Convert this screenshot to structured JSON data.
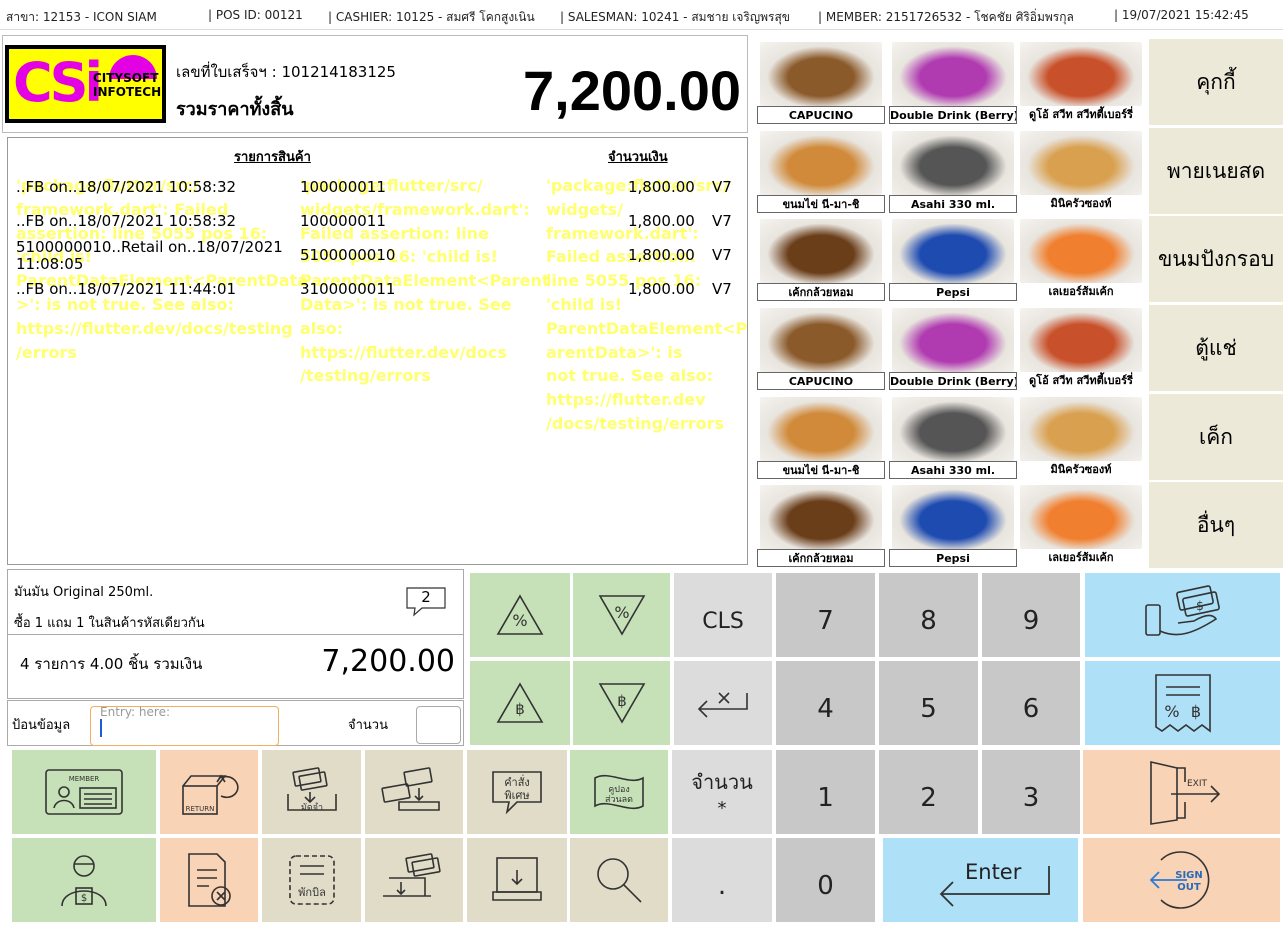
{
  "topbar": {
    "branch": "สาขา: 12153 - ICON SIAM",
    "pos": "| POS ID: 00121",
    "cashier": "| CASHIER: 10125 - สมศรี โคกสูงเนิน",
    "salesman": "| SALESMAN: 10241 - สมชาย เจริญพรสุข",
    "member": "| MEMBER: 2151726532 - โชคชัย ศิริอิ่มพรกุล",
    "datetime": "| 19/07/2021 15:42:45"
  },
  "header": {
    "logo_line1": "CITYSOFT",
    "logo_line2": "INFOTECH",
    "logo_mark": "CSi",
    "receipt_no": "เลขที่ใบเสร็จฯ : 101214183125",
    "total_label": "รวมราคาทั้งสิ้น",
    "total_amount": "7,200.00"
  },
  "items": {
    "col_product": "รายการสินค้า",
    "col_amount": "จำนวนเงิน",
    "rows": [
      {
        "name": "..FB on..18/07/2021 10:58:32",
        "code": "100000011",
        "amount": "1,800.00",
        "vat": "V7"
      },
      {
        "name": "..FB on..18/07/2021 10:58:32",
        "code": "100000011",
        "amount": "1,800.00",
        "vat": "V7"
      },
      {
        "name": "5100000010..Retail on..18/07/2021 11:08:05",
        "code": "5100000010",
        "amount": "1,800.00",
        "vat": "V7"
      },
      {
        "name": "..FB on..18/07/2021 11:44:01",
        "code": "3100000011",
        "amount": "1,800.00",
        "vat": "V7"
      }
    ],
    "error_col1": "'package:flutter/src/ framework.dart': Failed assertion: line 5055 pos 16: 'child is! ParentDataElement<ParentData >': is not true. See also: https://flutter.dev/docs/testing /errors",
    "error_col2": "'package:flutter/src/ widgets/framework.dart': Failed assertion: line 5055 pos 16: 'child is! ParentDataElement<Parent Data>': is not true. See also: https://flutter.dev/docs /testing/errors",
    "error_col3": "'package:flutter/src/ widgets/ framework.dart': Failed assertion: line 5055 pos 16: 'child is! ParentDataElement<P arentData>': is not true. See also: https://flutter.dev /docs/testing/errors"
  },
  "products": [
    {
      "label": "CAPUCINO",
      "color": "#8b5a2b"
    },
    {
      "label": "Double Drink (Berry)",
      "color": "#b03ab0"
    },
    {
      "label": "ดูโอ้ สวีท สวีทตี้เบอร์รี่",
      "color": "#c8502a"
    },
    {
      "label": "ขนมไข่ นี-มา-ชิ",
      "color": "#d08a3a"
    },
    {
      "label": "Asahi 330 ml.",
      "color": "#555555"
    },
    {
      "label": "มินิครัวซองท์",
      "color": "#d9a050"
    },
    {
      "label": "เค้กกล้วยหอม",
      "color": "#6b3e1a"
    },
    {
      "label": "Pepsi",
      "color": "#1e4bb0"
    },
    {
      "label": "เลเยอร์ส้มเค้ก",
      "color": "#f08030"
    },
    {
      "label": "CAPUCINO",
      "color": "#8b5a2b"
    },
    {
      "label": "Double Drink (Berry)",
      "color": "#b03ab0"
    },
    {
      "label": "ดูโอ้ สวีท สวีทตี้เบอร์รี่",
      "color": "#c8502a"
    },
    {
      "label": "ขนมไข่ นี-มา-ชิ",
      "color": "#d08a3a"
    },
    {
      "label": "Asahi 330 ml.",
      "color": "#555555"
    },
    {
      "label": "มินิครัวซองท์",
      "color": "#d9a050"
    },
    {
      "label": "เค้กกล้วยหอม",
      "color": "#6b3e1a"
    },
    {
      "label": "Pepsi",
      "color": "#1e4bb0"
    },
    {
      "label": "เลเยอร์ส้มเค้ก",
      "color": "#f08030"
    }
  ],
  "categories": [
    "คุกกี้",
    "พายเนยสด",
    "ขนมปังกรอบ",
    "ตู้แช่",
    "เค็ก",
    "อื่นๆ"
  ],
  "detail": {
    "item_name": "มันมัน Original 250ml.",
    "promo": "ซื้อ 1 แถม 1 ในสินค้ารหัสเดียวกัน",
    "promo_count": "2",
    "summary": "4 รายการ 4.00 ชิ้น รวมเงิน",
    "summary_amount": "7,200.00"
  },
  "entry": {
    "label": "ป้อนข้อมูล",
    "placeholder": "Entry: here:",
    "qty_label": "จำนวน"
  },
  "keypad": {
    "cls": "CLS",
    "qty": "จำนวน",
    "star": "*",
    "dot": ".",
    "enter": "Enter",
    "n7": "7",
    "n8": "8",
    "n9": "9",
    "n4": "4",
    "n5": "5",
    "n6": "6",
    "n1": "1",
    "n2": "2",
    "n3": "3",
    "n0": "0"
  },
  "icons": {
    "member_text": "MEMBER",
    "return_text": "RETURN",
    "deposit_text": "มัดจำ",
    "special_text1": "คำสั่ง",
    "special_text2": "พิเศษ",
    "coupon_text1": "คูปอง",
    "coupon_text2": "ส่วนลด",
    "hold_text": "พักบิล",
    "exit_text": "EXIT",
    "sign_text1": "SIGN",
    "sign_text2": "OUT"
  }
}
